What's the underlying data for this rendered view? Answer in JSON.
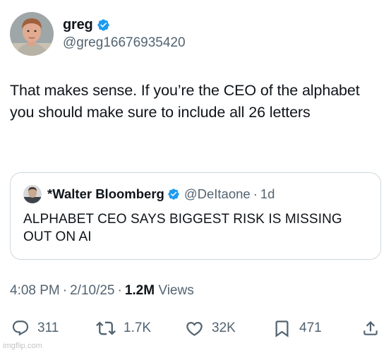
{
  "author": {
    "display_name": "greg",
    "handle": "@greg16676935420",
    "verified": true
  },
  "tweet": {
    "text": "That makes sense. If you’re the CEO of the alphabet you should make sure to include all 26 letters"
  },
  "quoted_tweet": {
    "display_name": "*Walter Bloomberg",
    "verified": true,
    "handle": "@DeItaone",
    "separator": "·",
    "time": "1d",
    "text": "ALPHABET CEO SAYS BIGGEST RISK IS MISSING OUT ON AI"
  },
  "meta": {
    "time": "4:08 PM",
    "separator": "·",
    "date": "2/10/25",
    "views_count": "1.2M",
    "views_label": "Views"
  },
  "actions": {
    "replies": "311",
    "reposts": "1.7K",
    "likes": "32K",
    "bookmarks": "471"
  },
  "watermark": "imgflip.com",
  "colors": {
    "verified_badge": "#1d9bf0",
    "secondary_text": "#536471",
    "primary_text": "#0f1419",
    "border": "#cfd9de"
  },
  "icons": {
    "reply": "speech-bubble-icon",
    "repost": "repost-arrows-icon",
    "like": "heart-icon",
    "bookmark": "bookmark-icon",
    "share": "share-upload-icon",
    "verified": "verified-badge-icon"
  }
}
